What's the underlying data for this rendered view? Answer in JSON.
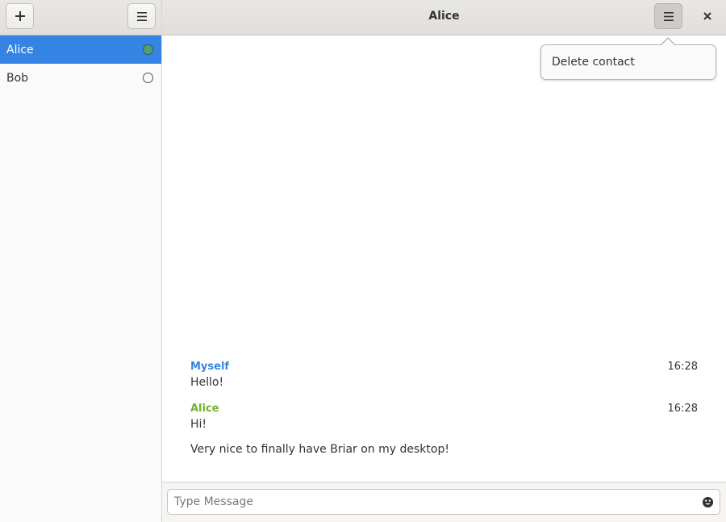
{
  "sidebar": {
    "add_icon": "plus-icon",
    "menu_icon": "hamburger-menu-icon",
    "contacts": [
      {
        "name": "Alice",
        "status": "online",
        "selected": true
      },
      {
        "name": "Bob",
        "status": "offline",
        "selected": false
      }
    ]
  },
  "header": {
    "title": "Alice",
    "menu_icon": "hamburger-menu-icon",
    "close_icon": "close-icon"
  },
  "popover": {
    "items": [
      {
        "label": "Delete contact"
      }
    ]
  },
  "messages": [
    {
      "author": "Myself",
      "time": "16:28",
      "texts": [
        "Hello!"
      ],
      "is_me": true
    },
    {
      "author": "Alice",
      "time": "16:28",
      "texts": [
        "Hi!",
        "Very nice to finally have Briar on my desktop!"
      ],
      "is_me": false
    }
  ],
  "composer": {
    "placeholder": "Type Message",
    "value": "",
    "emoji_icon": "emoji-icon"
  },
  "colors": {
    "accent": "#3584e4",
    "online": "#5aa55f",
    "peer_name": "#73b32e"
  }
}
